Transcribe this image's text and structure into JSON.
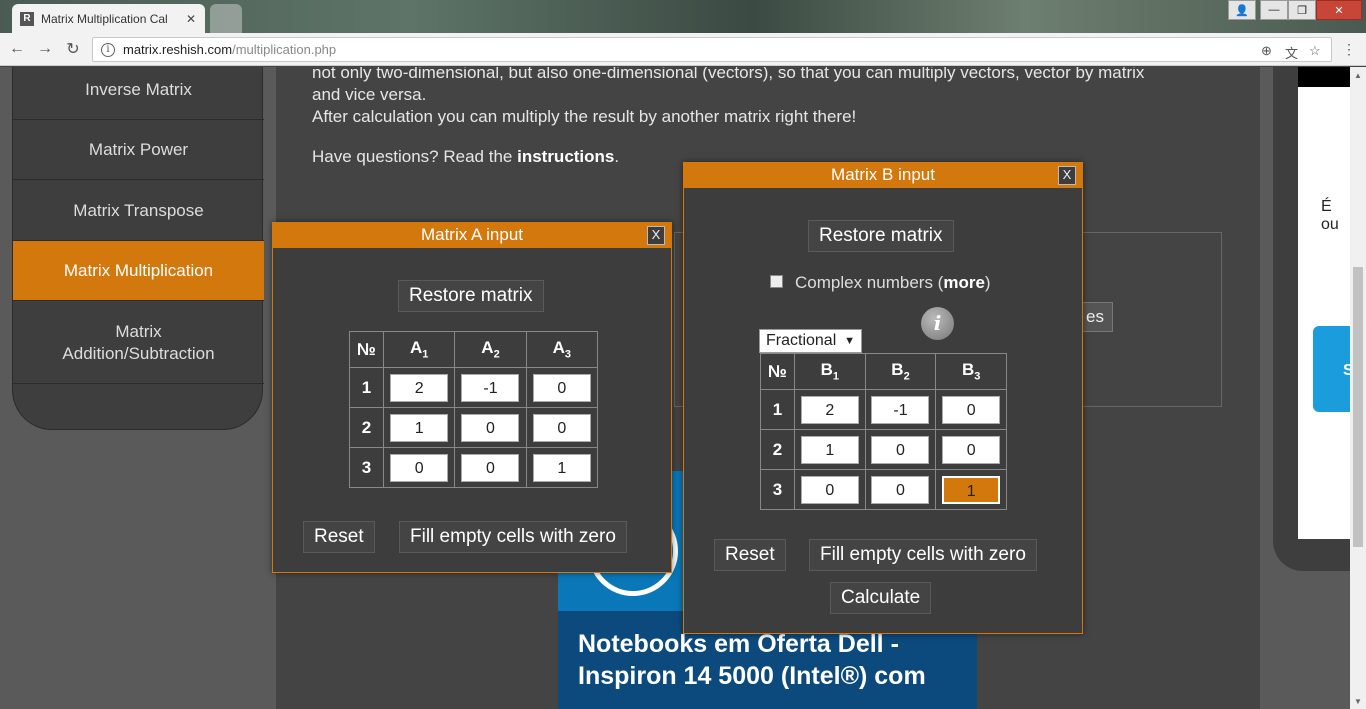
{
  "browser": {
    "active_tab": "Matrix Multiplication Cal",
    "tab_close": "✕",
    "inactive_tab_1": "",
    "url_host": "matrix.reshish.com",
    "url_path": "/multiplication.php"
  },
  "sidebar": {
    "items": [
      {
        "label": "Inverse Matrix"
      },
      {
        "label": "Matrix Power"
      },
      {
        "label": "Matrix Transpose"
      },
      {
        "label": "Matrix Multiplication"
      },
      {
        "label_line1": "Matrix",
        "label_line2": "Addition/Subtraction"
      }
    ]
  },
  "content": {
    "line1": "not only two-dimensional, but also one-dimensional (vectors), so that you can multiply vectors, vector by matrix",
    "line2": "and vice versa.",
    "line3": "After calculation you can multiply the result by another matrix right there!",
    "questions_prefix": "Have questions? Read the ",
    "instructions_link": "instructions",
    "questions_suffix": ".",
    "behind_button": "es"
  },
  "ad": {
    "headline_line1": "Notebooks em Oferta Dell -",
    "headline_line2": "Inspiron 14 5000 (Intel®) com"
  },
  "right_panel": {
    "text": "É ou",
    "button": "S"
  },
  "dialog_a": {
    "title": "Matrix A input",
    "close": "X",
    "restore": "Restore matrix",
    "corner_header": "№",
    "col_headers": [
      "A",
      "A",
      "A"
    ],
    "col_subs": [
      "1",
      "2",
      "3"
    ],
    "row_numbers": [
      "1",
      "2",
      "3"
    ],
    "cells": [
      [
        "2",
        "-1",
        "0"
      ],
      [
        "1",
        "0",
        "0"
      ],
      [
        "0",
        "0",
        "1"
      ]
    ],
    "reset": "Reset",
    "fill_zero": "Fill empty cells with zero"
  },
  "dialog_b": {
    "title": "Matrix B input",
    "close": "X",
    "restore": "Restore matrix",
    "complex_label": "Complex numbers (",
    "complex_more": "more",
    "complex_close": ")",
    "info_icon": "i",
    "number_format": "Fractional",
    "corner_header": "№",
    "col_headers": [
      "B",
      "B",
      "B"
    ],
    "col_subs": [
      "1",
      "2",
      "3"
    ],
    "row_numbers": [
      "1",
      "2",
      "3"
    ],
    "cells": [
      [
        "2",
        "-1",
        "0"
      ],
      [
        "1",
        "0",
        "0"
      ],
      [
        "0",
        "0",
        "1"
      ]
    ],
    "reset": "Reset",
    "fill_zero": "Fill empty cells with zero",
    "calculate": "Calculate"
  },
  "colors": {
    "accent": "#d3780d",
    "panel": "#3d3d3d"
  }
}
